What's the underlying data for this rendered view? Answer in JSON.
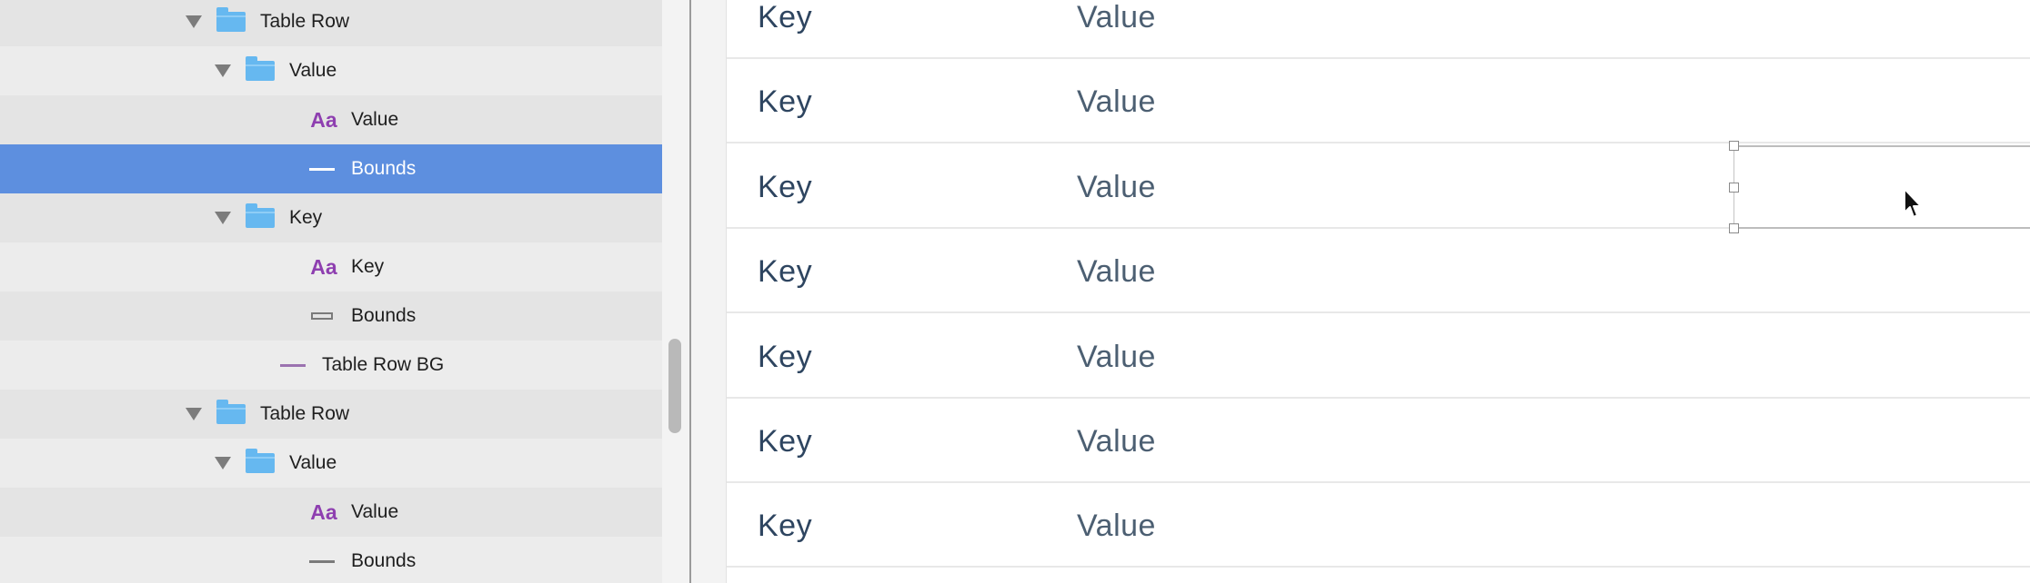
{
  "layers": [
    {
      "label": "Table Row",
      "type": "group",
      "depth": 0,
      "shade": "even"
    },
    {
      "label": "Value",
      "type": "group",
      "depth": 1,
      "shade": "odd"
    },
    {
      "label": "Value",
      "type": "text",
      "depth": 2,
      "shade": "even"
    },
    {
      "label": "Bounds",
      "type": "line",
      "depth": 2,
      "shade": "selected",
      "icon_variant": "white"
    },
    {
      "label": "Key",
      "type": "group",
      "depth": 1,
      "shade": "even"
    },
    {
      "label": "Key",
      "type": "text",
      "depth": 2,
      "shade": "odd"
    },
    {
      "label": "Bounds",
      "type": "rect",
      "depth": 2,
      "shade": "even"
    },
    {
      "label": "Table Row BG",
      "type": "line",
      "depth": 1,
      "shade": "odd",
      "icon_variant": "purple"
    },
    {
      "label": "Table Row",
      "type": "group",
      "depth": 0,
      "shade": "even"
    },
    {
      "label": "Value",
      "type": "group",
      "depth": 1,
      "shade": "odd"
    },
    {
      "label": "Value",
      "type": "text",
      "depth": 2,
      "shade": "even"
    },
    {
      "label": "Bounds",
      "type": "line",
      "depth": 2,
      "shade": "odd"
    }
  ],
  "text_icon_glyph": "Aa",
  "table": {
    "rows": [
      {
        "key": "Key",
        "value": "Value"
      },
      {
        "key": "Key",
        "value": "Value"
      },
      {
        "key": "Key",
        "value": "Value"
      },
      {
        "key": "Key",
        "value": "Value"
      },
      {
        "key": "Key",
        "value": "Value"
      },
      {
        "key": "Key",
        "value": "Value"
      },
      {
        "key": "Key",
        "value": "Value"
      }
    ]
  },
  "selected_layer_index": 3,
  "selected_table_row": 2,
  "colors": {
    "selection": "#5d8fdf",
    "folder": "#66b8f0",
    "text_icon": "#8e3fb0",
    "key_text": "#2e4560",
    "value_text": "#4c5f72"
  }
}
